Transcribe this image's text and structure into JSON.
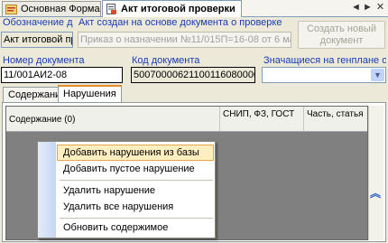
{
  "tabs": [
    {
      "label": "Основная Форма",
      "active": false,
      "icon": "form-icon"
    },
    {
      "label": "Акт итоговой проверки",
      "active": true,
      "icon": "document-icon"
    }
  ],
  "window_controls": {
    "prev": "◄",
    "next": "►",
    "close": "✕"
  },
  "basis": {
    "label": "Обозначение доку",
    "value": "Акт итоговой пров",
    "note": "Акт создан на основе документа о проверке",
    "source_doc": "Приказ о назначении №11/015П=16-08 от 6 марта 200",
    "create_button": "Создать новый документ"
  },
  "doc_number": {
    "label": "Номер документа",
    "value": "11/001АИ2-08"
  },
  "doc_code": {
    "label": "Код документа",
    "value": "5007000062110011608000002"
  },
  "genplan": {
    "label": "Значащиеся на генплане объек",
    "value": ""
  },
  "subtabs": [
    {
      "label": "Содержание",
      "active": false
    },
    {
      "label": "Нарушения",
      "active": true
    }
  ],
  "grid": {
    "columns": [
      "Содержание (0)",
      "СНИП, ФЗ, ГОСТ",
      "Часть, статья"
    ]
  },
  "context_menu": [
    {
      "label": "Добавить нарушения из базы",
      "selected": true
    },
    {
      "label": "Добавить пустое нарушение",
      "selected": false
    },
    {
      "separator": true
    },
    {
      "label": "Удалить нарушение",
      "selected": false
    },
    {
      "label": "Удалить все нарушения",
      "selected": false
    },
    {
      "separator": true
    },
    {
      "label": "Обновить содержимое",
      "selected": false
    }
  ]
}
